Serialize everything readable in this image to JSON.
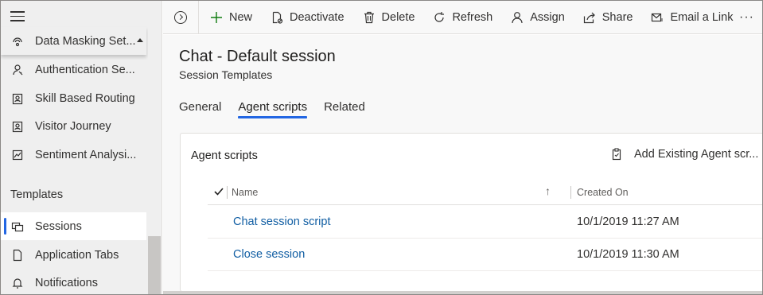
{
  "sidebar": {
    "items": [
      {
        "label": "Data Masking Set...",
        "icon": "data-masking-icon"
      },
      {
        "label": "Authentication Se...",
        "icon": "authentication-icon"
      },
      {
        "label": "Skill Based Routing",
        "icon": "skill-routing-icon"
      },
      {
        "label": "Visitor Journey",
        "icon": "visitor-journey-icon"
      },
      {
        "label": "Sentiment Analysi...",
        "icon": "sentiment-icon"
      }
    ],
    "section_title": "Templates",
    "template_items": [
      {
        "label": "Sessions",
        "icon": "sessions-icon",
        "selected": true
      },
      {
        "label": "Application Tabs",
        "icon": "application-tabs-icon"
      },
      {
        "label": "Notifications",
        "icon": "notifications-icon"
      }
    ]
  },
  "commands": {
    "new": "New",
    "deactivate": "Deactivate",
    "delete": "Delete",
    "refresh": "Refresh",
    "assign": "Assign",
    "share": "Share",
    "email_link": "Email a Link",
    "more": "···"
  },
  "record": {
    "title": "Chat - Default session",
    "subtitle": "Session Templates"
  },
  "tabs": [
    {
      "label": "General"
    },
    {
      "label": "Agent scripts",
      "active": true
    },
    {
      "label": "Related"
    }
  ],
  "subgrid": {
    "title": "Agent scripts",
    "add_existing_label": "Add Existing Agent scr...",
    "columns": {
      "name": "Name",
      "created_on": "Created On"
    },
    "rows": [
      {
        "name": "Chat session script",
        "created_on": "10/1/2019 11:27 AM"
      },
      {
        "name": "Close session",
        "created_on": "10/1/2019 11:30 AM"
      }
    ]
  },
  "colors": {
    "accent": "#2266e3",
    "link": "#115ea3",
    "new_icon": "#107c10"
  }
}
